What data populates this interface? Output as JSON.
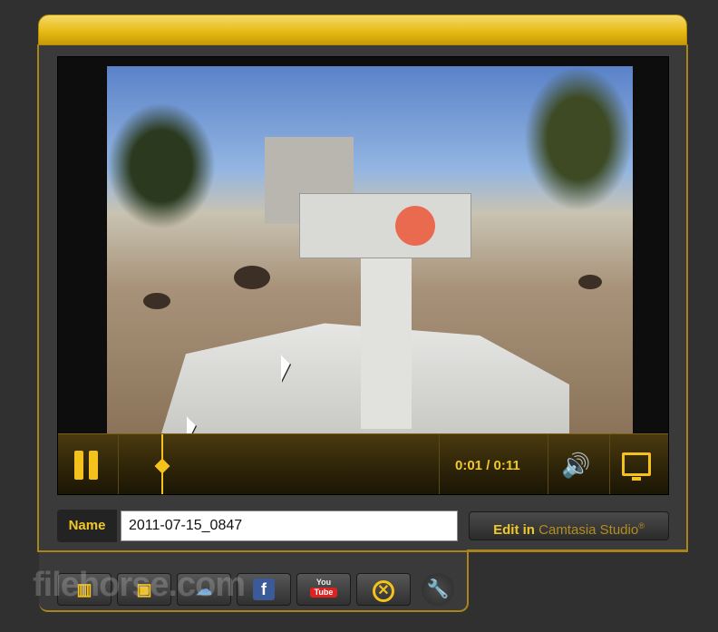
{
  "player": {
    "time_readout": "0:01 / 0:11",
    "pause_icon": "pause-icon",
    "volume_icon": "volume-icon",
    "fullscreen_icon": "monitor-icon",
    "progress_fraction": 0.09
  },
  "name_field": {
    "label": "Name",
    "value": "2011-07-15_0847"
  },
  "edit_button": {
    "prefix": "Edit in",
    "product": "Camtasia Studio",
    "mark": "®"
  },
  "share": {
    "facebook_icon_text": "f",
    "youtube_top": "You",
    "youtube_bottom": "Tube",
    "close_icon_text": "✕",
    "wrench_icon_text": "🔧"
  },
  "watermark": "filehorse.com",
  "colors": {
    "accent": "#f4c21a",
    "panel": "#3a3a3a",
    "frame_border": "#a8841a"
  }
}
